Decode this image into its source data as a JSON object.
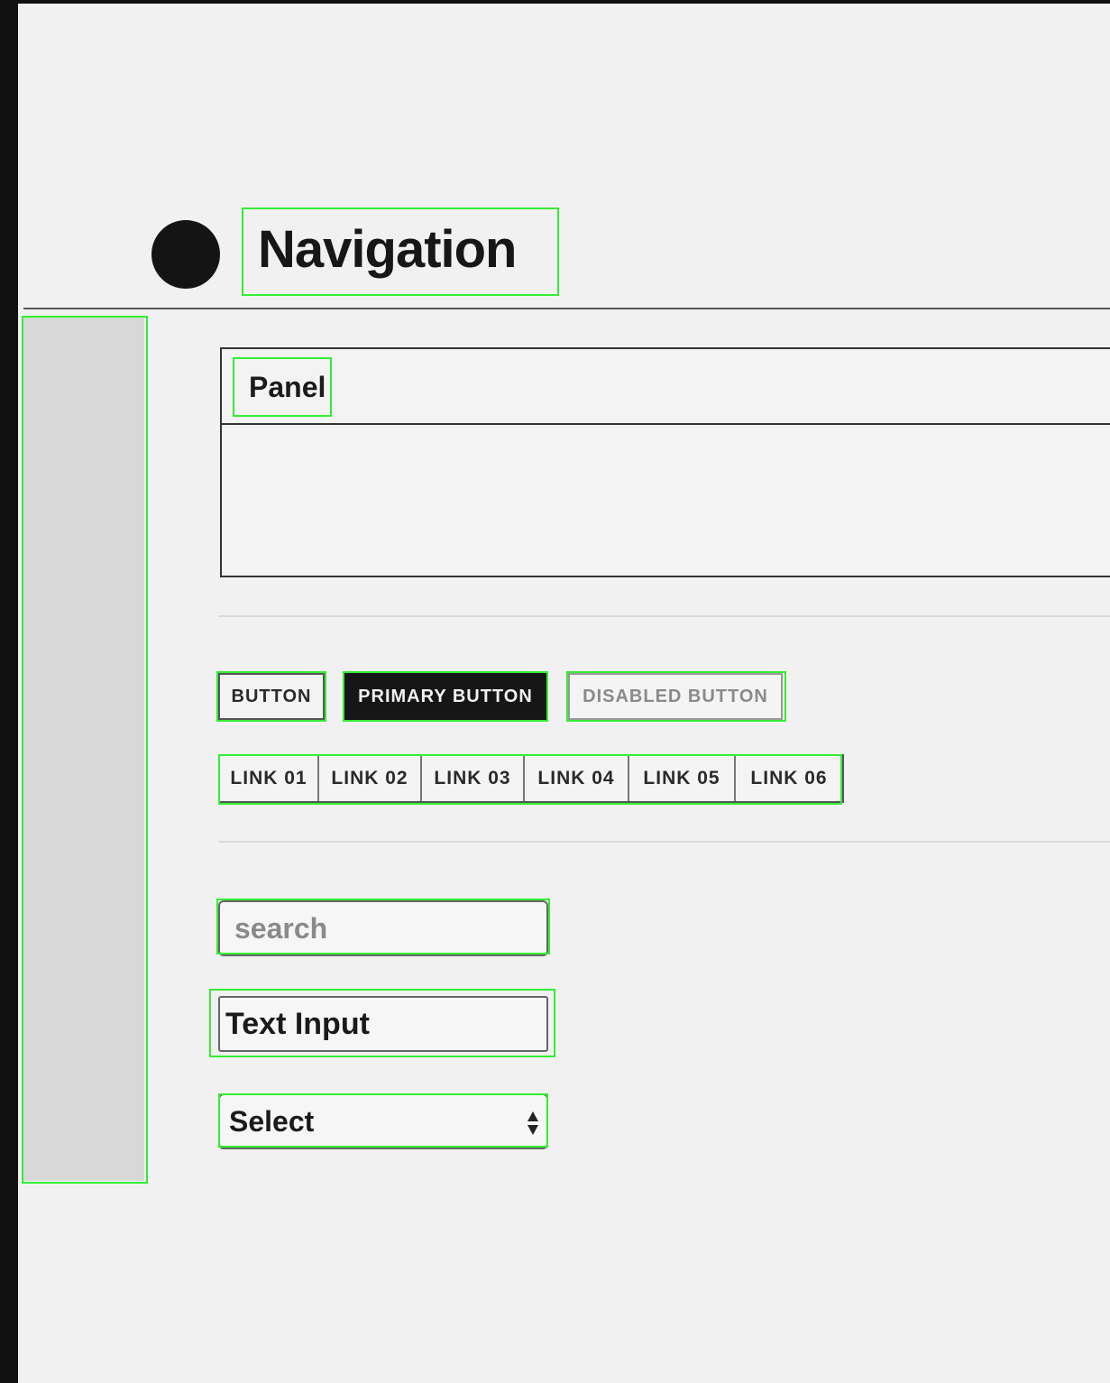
{
  "header": {
    "title": "Navigation"
  },
  "panel": {
    "title": "Panel"
  },
  "buttons": {
    "default": "BUTTON",
    "primary": "PRIMARY BUTTON",
    "disabled": "DISABLED BUTTON"
  },
  "links": [
    "LINK 01",
    "LINK 02",
    "LINK 03",
    "LINK 04",
    "LINK 05",
    "LINK 06"
  ],
  "form": {
    "search_placeholder": "search",
    "text_input_value": "Text Input",
    "select_value": "Select"
  },
  "colors": {
    "annotation": "#33ee33",
    "primary": "#161616",
    "background": "#f1f1f1"
  }
}
